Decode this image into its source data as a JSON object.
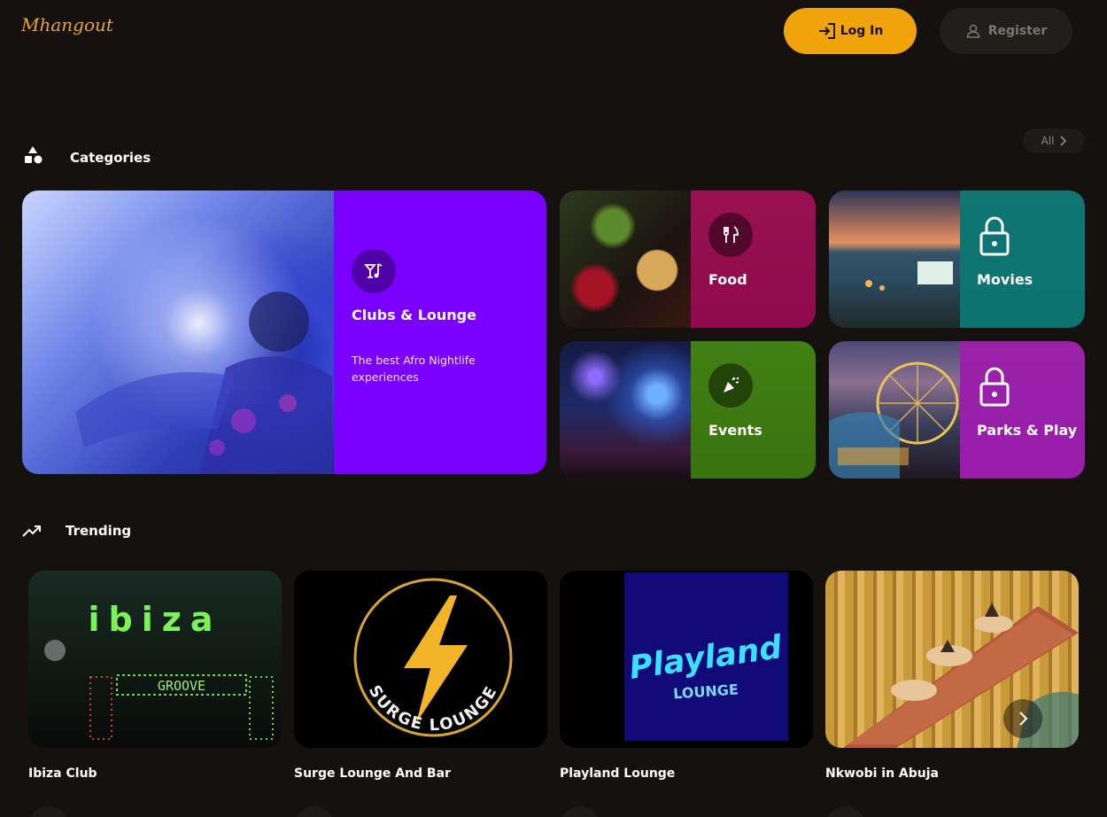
{
  "brand": {
    "logo_text": "Mhangout",
    "color": "#e8a33b"
  },
  "header": {
    "login_label": "Log In",
    "register_label": "Register",
    "login_color": "#f0a30a"
  },
  "categories": {
    "title": "Categories",
    "all_label": "All",
    "featured": {
      "label": "Clubs & Lounge",
      "description": "The best Afro Nightlife experiences",
      "icon": "cocktail-music-icon",
      "color": "#7a00ff"
    },
    "items": [
      {
        "label": "Food",
        "icon": "utensils-icon",
        "color": "#b0115c",
        "locked": false
      },
      {
        "label": "Movies",
        "icon": "lock-icon",
        "color": "#0f8785",
        "locked": true
      },
      {
        "label": "Events",
        "icon": "party-popper-icon",
        "color": "#3f7a12",
        "locked": false
      },
      {
        "label": "Parks & Play",
        "icon": "lock-icon",
        "color": "#b025c4",
        "locked": true
      }
    ]
  },
  "trending": {
    "title": "Trending",
    "items": [
      {
        "name": "Ibiza Club",
        "sign_text": "ibiza",
        "sub_text": "GROOVE"
      },
      {
        "name": "Surge Lounge And Bar",
        "sign_text": "SURGE LOUNGE"
      },
      {
        "name": "Playland Lounge",
        "sign_text": "Playland",
        "sub_text": "LOUNGE"
      },
      {
        "name": "Nkwobi in Abuja"
      }
    ]
  }
}
